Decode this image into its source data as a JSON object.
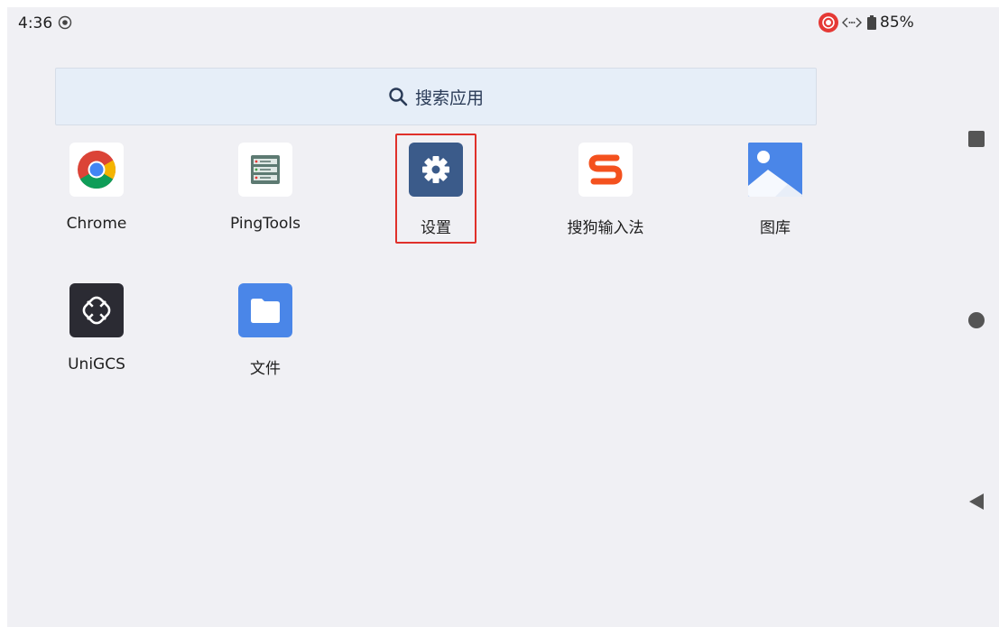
{
  "status_bar": {
    "time": "4:36",
    "battery": "85%"
  },
  "search": {
    "placeholder": "搜索应用"
  },
  "apps": [
    {
      "label": "Chrome",
      "icon": "chrome-icon"
    },
    {
      "label": "PingTools",
      "icon": "pingtools-icon"
    },
    {
      "label": "设置",
      "icon": "gear-icon"
    },
    {
      "label": "搜狗输入法",
      "icon": "sogou-icon"
    },
    {
      "label": "图库",
      "icon": "gallery-icon"
    },
    {
      "label": "UniGCS",
      "icon": "unigcs-icon"
    },
    {
      "label": "文件",
      "icon": "folder-icon"
    }
  ],
  "colors": {
    "highlight": "#e0302a",
    "settings_bg": "#3b5b8a",
    "files_bg": "#4a86e8",
    "unigcs_bg": "#2b2b33",
    "sogou": "#f4511e"
  }
}
